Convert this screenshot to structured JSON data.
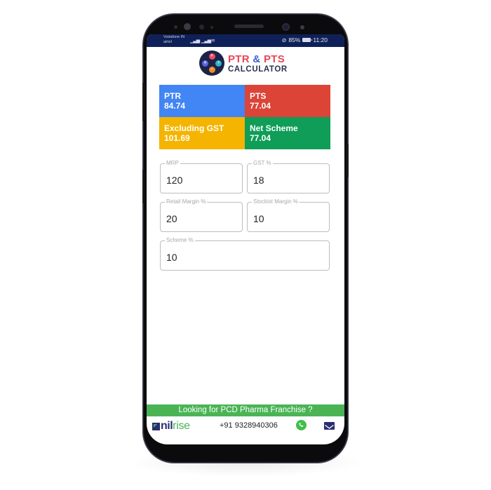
{
  "status_bar": {
    "carrier_line1": "Vodafone IN",
    "carrier_line2": "airtel",
    "battery": "85%",
    "time": "11:20"
  },
  "app": {
    "title_part1": "PTR",
    "title_amp": "&",
    "title_part2": "PTS",
    "subtitle": "CALCULATOR",
    "colors": {
      "title_red": "#e8465a",
      "title_blue": "#3d5fd6",
      "subtitle": "#2c3350"
    }
  },
  "results": [
    {
      "label": "PTR",
      "value": "84.74",
      "color": "#4285f4"
    },
    {
      "label": "PTS",
      "value": "77.04",
      "color": "#db4437"
    },
    {
      "label": "Excluding GST",
      "value": "101.69",
      "color": "#f4b400"
    },
    {
      "label": "Net Scheme",
      "value": "77.04",
      "color": "#0f9d58"
    }
  ],
  "fields": {
    "mrp": {
      "label": "MRP",
      "value": "120"
    },
    "gst": {
      "label": "GST %",
      "value": "18"
    },
    "retail_margin": {
      "label": "Retail Margin %",
      "value": "20"
    },
    "stockist_margin": {
      "label": "Stockist Margin %",
      "value": "10"
    },
    "scheme": {
      "label": "Scheme %",
      "value": "10"
    }
  },
  "banner": {
    "text": "Looking for PCD Pharma Franchise ?",
    "color": "#4ab455"
  },
  "footer": {
    "brand_nil": "nil",
    "brand_rise": "rise",
    "phone": "+91 9328940306",
    "icons": [
      "whatsapp-icon",
      "mail-icon"
    ]
  }
}
